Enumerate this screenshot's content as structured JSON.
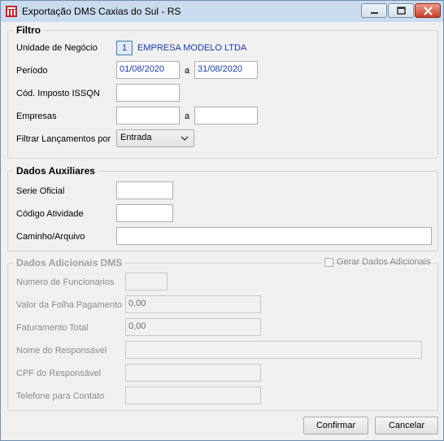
{
  "window": {
    "title": "Exportação DMS Caxias do Sul - RS"
  },
  "filtro": {
    "legend": "Filtro",
    "unidade_label": "Unidade de Negócio",
    "unidade_code": "1",
    "unidade_name": "EMPRESA MODELO LTDA",
    "periodo_label": "Período",
    "periodo_from": "01/08/2020",
    "periodo_sep": "a",
    "periodo_to": "31/08/2020",
    "cod_imposto_label": "Cód. Imposto ISSQN",
    "cod_imposto_value": "",
    "empresas_label": "Empresas",
    "empresas_from": "",
    "empresas_sep": "a",
    "empresas_to": "",
    "filtrar_label": "Filtrar Lançamentos por",
    "filtrar_value": "Entrada"
  },
  "auxiliares": {
    "legend": "Dados Auxiliares",
    "serie_label": "Serie Oficial",
    "serie_value": "",
    "codigo_label": "Código Atividade",
    "codigo_value": "",
    "caminho_label": "Caminho/Arquivo",
    "caminho_value": ""
  },
  "adicionais": {
    "legend": "Dados Adicionais DMS",
    "gerar_label": "Gerar Dados Adicionais",
    "gerar_checked": false,
    "funcionarios_label": "Numero de Funcionarios",
    "funcionarios_value": "",
    "folha_label": "Valor da Folha Pagamento",
    "folha_value": "0,00",
    "faturamento_label": "Faturamento Total",
    "faturamento_value": "0,00",
    "responsavel_label": "Nome do Responsável",
    "responsavel_value": "",
    "cpf_label": "CPF do Responsável",
    "cpf_value": "",
    "telefone_label": "Telefone para Contato",
    "telefone_value": ""
  },
  "buttons": {
    "confirmar": "Confirmar",
    "cancelar": "Cancelar"
  },
  "icons": {
    "app": "app-logo-icon",
    "minimize": "minimize-icon",
    "maximize": "maximize-icon",
    "close": "close-icon"
  },
  "colors": {
    "titlebar": "#c9dbee",
    "value_blue": "#1a3ca8",
    "close_red": "#c7412a"
  }
}
